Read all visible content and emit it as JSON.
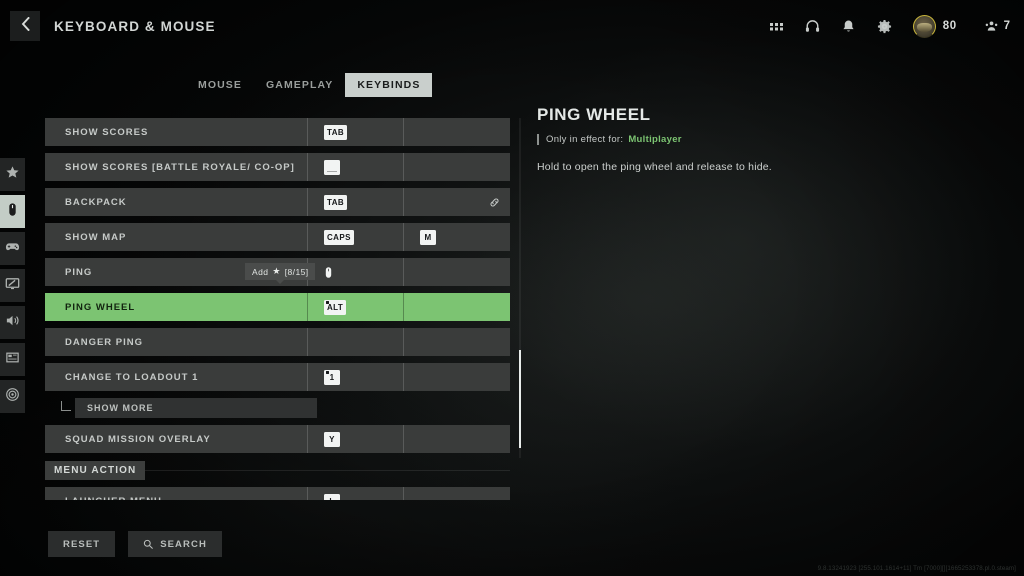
{
  "header": {
    "back_icon": "chevron-left-icon",
    "title": "KEYBOARD & MOUSE",
    "icons": [
      {
        "name": "grid-apps-icon",
        "label": ""
      },
      {
        "name": "headset-icon",
        "label": ""
      },
      {
        "name": "bell-notification-icon",
        "label": ""
      },
      {
        "name": "gear-settings-icon",
        "label": ""
      }
    ],
    "player_level": "80",
    "squad_count": "7"
  },
  "rail": {
    "items": [
      {
        "name": "sidebar-item-favorites",
        "icon": "star-icon",
        "active": false
      },
      {
        "name": "sidebar-item-keyboard-mouse",
        "icon": "mouse-icon",
        "active": true
      },
      {
        "name": "sidebar-item-controller",
        "icon": "gamepad-icon",
        "active": false
      },
      {
        "name": "sidebar-item-graphics",
        "icon": "monitor-icon",
        "active": false
      },
      {
        "name": "sidebar-item-audio",
        "icon": "speaker-icon",
        "active": false
      },
      {
        "name": "sidebar-item-interface",
        "icon": "hud-layout-icon",
        "active": false
      },
      {
        "name": "sidebar-item-accessibility",
        "icon": "accessibility-icon",
        "active": false
      }
    ]
  },
  "tabs": [
    {
      "label": "MOUSE",
      "active": false
    },
    {
      "label": "GAMEPLAY",
      "active": false
    },
    {
      "label": "KEYBINDS",
      "active": true
    }
  ],
  "list": [
    {
      "type": "row",
      "label": "SHOW SCORES",
      "selected": false,
      "link": false,
      "bind1": {
        "kind": "key",
        "text": "TAB"
      },
      "bind2": {
        "kind": "empty"
      }
    },
    {
      "type": "row",
      "label": "SHOW SCORES [BATTLE ROYALE/ CO-OP]",
      "selected": false,
      "link": false,
      "bind1": {
        "kind": "blank",
        "text": ""
      },
      "bind2": {
        "kind": "empty"
      }
    },
    {
      "type": "row",
      "label": "BACKPACK",
      "selected": false,
      "link": true,
      "bind1": {
        "kind": "key",
        "text": "TAB"
      },
      "bind2": {
        "kind": "empty"
      }
    },
    {
      "type": "row",
      "label": "SHOW MAP",
      "selected": false,
      "link": false,
      "bind1": {
        "kind": "key",
        "text": "CAPS"
      },
      "bind2": {
        "kind": "key",
        "text": "M"
      }
    },
    {
      "type": "row",
      "label": "PING",
      "selected": false,
      "link": false,
      "tooltip": {
        "prefix": "Add",
        "star": "★",
        "count": "[8/15]"
      },
      "bind1": {
        "kind": "mouse",
        "text": ""
      },
      "bind2": {
        "kind": "empty"
      }
    },
    {
      "type": "row",
      "label": "PING WHEEL",
      "selected": true,
      "link": false,
      "bind1": {
        "kind": "key",
        "text": "ALT",
        "mod": true
      },
      "bind2": {
        "kind": "empty"
      }
    },
    {
      "type": "row",
      "label": "DANGER PING",
      "selected": false,
      "link": false,
      "bind1": {
        "kind": "empty"
      },
      "bind2": {
        "kind": "empty"
      }
    },
    {
      "type": "row",
      "label": "CHANGE TO LOADOUT 1",
      "selected": false,
      "link": false,
      "bind1": {
        "kind": "key",
        "text": "1",
        "mod": true
      },
      "bind2": {
        "kind": "empty"
      }
    },
    {
      "type": "subrow",
      "label": "SHOW MORE"
    },
    {
      "type": "row",
      "label": "SQUAD MISSION OVERLAY",
      "selected": false,
      "link": false,
      "bind1": {
        "kind": "key",
        "text": "Y"
      },
      "bind2": {
        "kind": "empty"
      }
    },
    {
      "type": "section",
      "label": "MENU ACTION"
    },
    {
      "type": "row",
      "label": "LAUNCHER MENU",
      "selected": false,
      "link": false,
      "bind1": {
        "kind": "key",
        "text": "L"
      },
      "bind2": {
        "kind": "empty"
      }
    }
  ],
  "detail": {
    "title": "PING WHEEL",
    "effect_label": "Only in effect for:",
    "effect_value": "Multiplayer",
    "description": "Hold to open the ping wheel and release to hide."
  },
  "footer": {
    "reset_label": "RESET",
    "search_label": "SEARCH",
    "search_icon": "magnifier-icon"
  },
  "build_string": "9.8.13241923 [255.101.1614+11] Tm [7000][][1665253378.pl.0.steam]",
  "colors": {
    "accent_green": "#7cc472",
    "panel": "#3a3c3b",
    "tab_active_bg": "#c9cfcc",
    "level_ring": "#c9b63b"
  }
}
